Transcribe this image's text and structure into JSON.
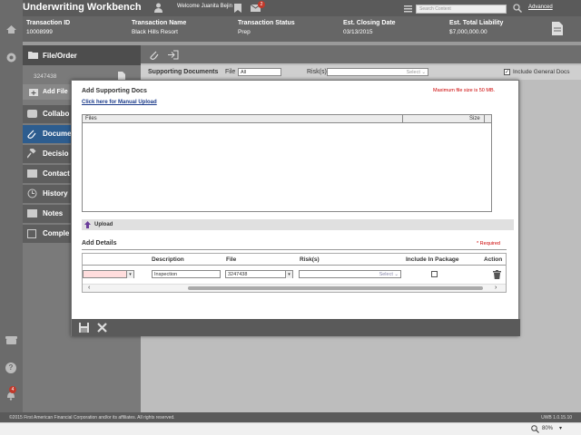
{
  "app": {
    "title": "Underwriting Workbench",
    "welcome": "Welcome Juanita Bejin",
    "notification_count": "2",
    "search_placeholder": "Search Content",
    "advanced_link": "Advanced"
  },
  "transaction": {
    "headers": [
      "Transaction ID",
      "Transaction Name",
      "Transaction Status",
      "Est. Closing Date",
      "Est. Total Liability"
    ],
    "values": [
      "10008999",
      "Black Hills Resort",
      "Prep",
      "03/13/2015",
      "$7,000,000.00"
    ]
  },
  "left_panel": {
    "header": "File/Order",
    "order_number": "3247438",
    "add_file_label": "Add File",
    "items": [
      "Collabo",
      "Docume",
      "Decisio",
      "Contact",
      "History",
      "Notes",
      "Comple"
    ]
  },
  "sidebar": {
    "alert_count": "4"
  },
  "supporting_docs": {
    "label": "Supporting Documents",
    "file_label": "File",
    "file_value": "All",
    "risks_label": "Risk(s)",
    "risks_placeholder": "Select",
    "include_general": "Include General Docs"
  },
  "modal": {
    "title": "Add Supporting Docs",
    "max_size": "Maximum file size is 50 MB.",
    "manual_upload": "Click here for Manual Upload",
    "files_col": "Files",
    "size_col": "Size",
    "upload_label": "Upload",
    "add_details": "Add Details",
    "required": "* Required",
    "columns": [
      "Description",
      "File",
      "Risk(s)",
      "Include In Package",
      "Action"
    ],
    "row": {
      "description": "Inspection",
      "file": "3247438",
      "risks": "Select"
    }
  },
  "footer": {
    "copyright": "©2015 First American Financial Corporation and/or its affiliates. All rights reserved.",
    "version": "UWB 1.0.15.10"
  },
  "statusbar": {
    "zoom": "80%"
  }
}
